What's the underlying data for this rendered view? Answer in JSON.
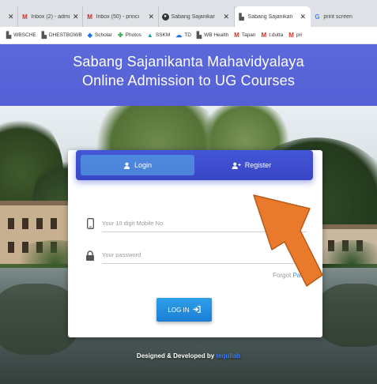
{
  "browser": {
    "tabs": [
      {
        "favicon": "close-partial",
        "title": "",
        "active": false
      },
      {
        "favicon": "gmail-icon",
        "title": "Inbox (2) - admis",
        "active": false
      },
      {
        "favicon": "gmail-icon",
        "title": "Inbox (50) - princi",
        "active": false
      },
      {
        "favicon": "chrome-icon",
        "title": "Sabang Sajanikar",
        "active": false
      },
      {
        "favicon": "document-icon",
        "title": "Sabang Sajanikan",
        "active": true
      },
      {
        "favicon": "google-icon",
        "title": "print screen",
        "active": false
      }
    ],
    "bookmarks": [
      {
        "icon": "document-icon",
        "label": "WBSCHE"
      },
      {
        "icon": "document-icon",
        "label": "DHESTBGWB"
      },
      {
        "icon": "scholar-icon",
        "label": "Scholar"
      },
      {
        "icon": "photos-icon",
        "label": "Photos"
      },
      {
        "icon": "ssk-icon",
        "label": "SSKM"
      },
      {
        "icon": "cloud-icon",
        "label": "TD"
      },
      {
        "icon": "document-icon",
        "label": "WB Health"
      },
      {
        "icon": "gmail-icon",
        "label": "Tapan"
      },
      {
        "icon": "gmail-icon",
        "label": "t.dutta"
      },
      {
        "icon": "gmail-icon",
        "label": "pri"
      }
    ]
  },
  "header": {
    "line1": "Sabang Sajanikanta Mahavidyalaya",
    "line2": "Online Admission to UG Courses"
  },
  "card": {
    "tabs": {
      "login": "Login",
      "register": "Register"
    },
    "mobile_placeholder": "Your 10 digit Mobile No",
    "password_placeholder": "Your password",
    "forgot_prefix": "Forgot ",
    "forgot_link": "Passw",
    "login_button": "LOG IN"
  },
  "footer": {
    "text": "Designed & Developed by ",
    "brand": "tequilab"
  },
  "colors": {
    "header_bg": "#5a67d8",
    "tabbar_bg": "#3f50d0",
    "login_button": "#2290e0",
    "arrow": "#ea7a2b"
  }
}
